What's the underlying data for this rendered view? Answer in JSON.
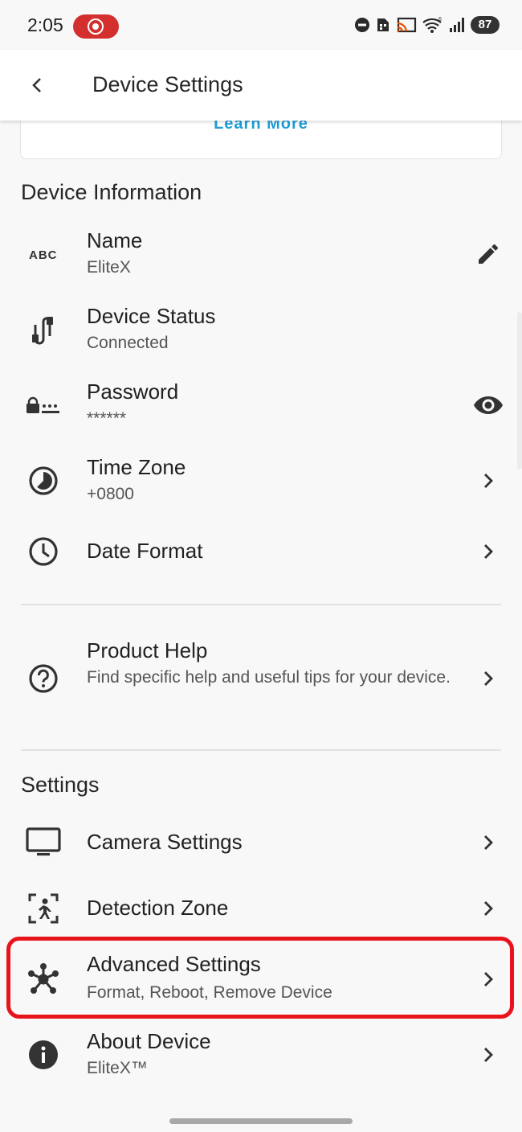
{
  "status_bar": {
    "time": "2:05",
    "battery": "87",
    "icons": [
      "screen-record-icon",
      "dnd-icon",
      "sim-icon",
      "cast-icon",
      "wifi-icon",
      "signal-icon",
      "battery-icon"
    ]
  },
  "app_bar": {
    "title": "Device Settings",
    "back_icon": "back-arrow-icon"
  },
  "promo_card": {
    "link_label": "Learn More"
  },
  "device_information": {
    "heading": "Device Information",
    "items": [
      {
        "title": "Name",
        "subtitle": "EliteX",
        "icon": "abc-icon",
        "trailing_icon": "edit-icon"
      },
      {
        "title": "Device Status",
        "subtitle": "Connected",
        "icon": "cable-icon"
      },
      {
        "title": "Password",
        "subtitle": "******",
        "icon": "password-icon",
        "trailing_icon": "eye-icon"
      },
      {
        "title": "Time Zone",
        "subtitle": "+0800",
        "icon": "timezone-icon",
        "trailing_icon": "chevron-right-icon"
      },
      {
        "title": "Date Format",
        "icon": "clock-icon",
        "trailing_icon": "chevron-right-icon"
      }
    ]
  },
  "help": {
    "title": "Product Help",
    "subtitle": "Find specific help and useful tips for your device.",
    "icon": "help-icon"
  },
  "settings": {
    "heading": "Settings",
    "items": [
      {
        "title": "Camera Settings",
        "icon": "monitor-icon",
        "trailing_icon": "chevron-right-icon"
      },
      {
        "title": "Detection Zone",
        "icon": "detection-zone-icon",
        "trailing_icon": "chevron-right-icon"
      },
      {
        "title": "Advanced Settings",
        "subtitle": "Format, Reboot, Remove Device",
        "icon": "hub-icon",
        "trailing_icon": "chevron-right-icon",
        "highlighted": true
      },
      {
        "title": "About Device",
        "subtitle": "EliteX™",
        "icon": "info-icon",
        "trailing_icon": "chevron-right-icon"
      }
    ]
  },
  "colors": {
    "accent_link": "#1f9ed8",
    "highlight": "#e8141b",
    "record_pill": "#d32f2f"
  }
}
